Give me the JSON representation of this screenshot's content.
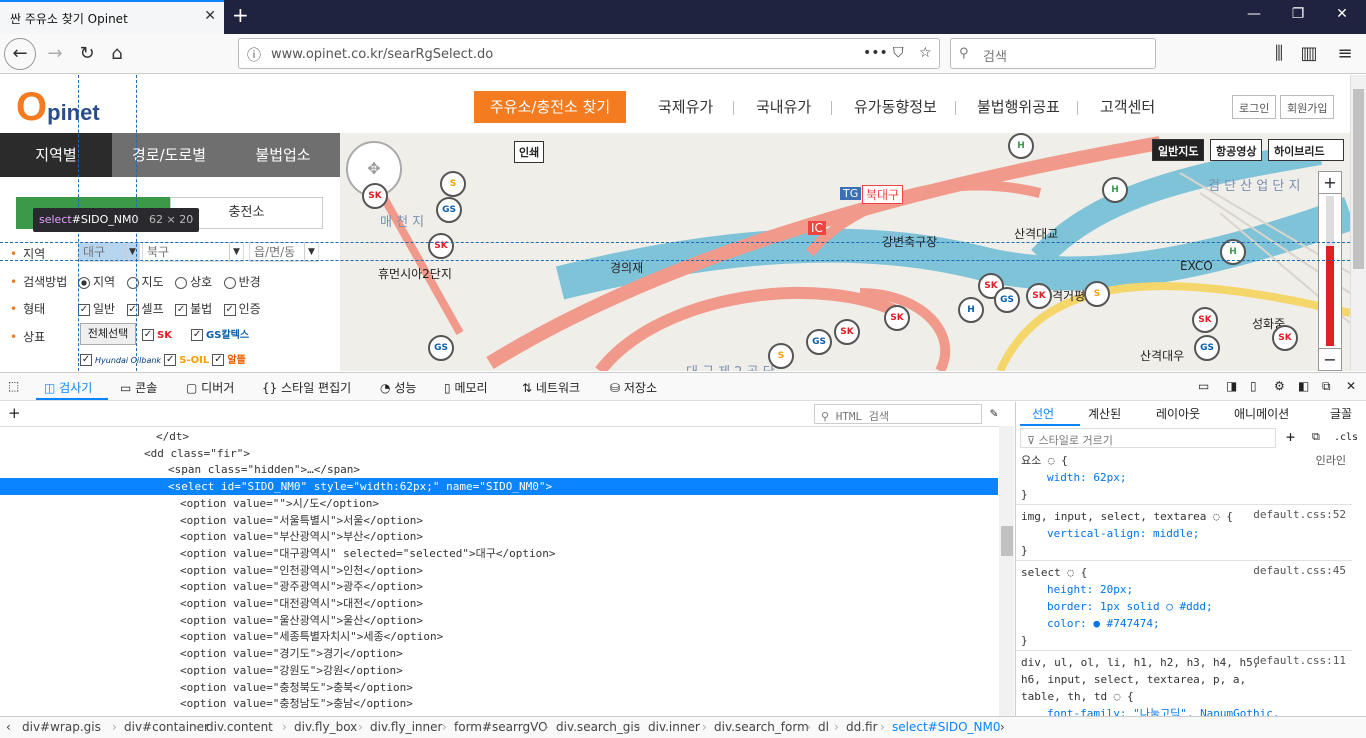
{
  "browser": {
    "tab_title": "싼 주유소 찾기 Opinet",
    "url": "www.opinet.co.kr/searRgSelect.do",
    "search_placeholder": "검색"
  },
  "site": {
    "logo_o": "O",
    "logo_rest": "pinet",
    "nav": [
      "주유소/충전소 찾기",
      "국제유가",
      "국내유가",
      "유가동향정보",
      "불법행위공표",
      "고객센터"
    ],
    "login": "로그인",
    "signup": "회원가입",
    "side_tabs": [
      "지역별",
      "경로/도로별",
      "불법업소"
    ],
    "fuel_tabs": [
      "주유소",
      "충전소"
    ],
    "region_label": "지역",
    "sido_value": "대구",
    "sigungu_value": "북구",
    "dong_value": "읍/면/동",
    "search_method_label": "검색방법",
    "search_methods": [
      "지역",
      "지도",
      "상호",
      "반경"
    ],
    "type_label": "형태",
    "types": [
      "일반",
      "셀프",
      "불법",
      "인증"
    ],
    "brand_label": "상표",
    "brand_all": "전체선택",
    "brands": [
      "SK",
      "GS칼텍스",
      "S-OIL",
      "알뜰"
    ],
    "brand_hyundai": "Hyundai Oilbank"
  },
  "map": {
    "print": "인쇄",
    "view_buttons": [
      "일반지도",
      "항공영상",
      "하이브리드"
    ],
    "labels": [
      "매 천 지",
      "휴먼시아2단지",
      "경의재",
      "북대구",
      "IC",
      "TG",
      "강변축구장",
      "산격대교",
      "EXCO",
      "검 단 산 업 단 지",
      "격거평",
      "성화중",
      "산격대우",
      "대 구 제 2 공 단"
    ],
    "zoom_plus": "+",
    "zoom_minus": "−"
  },
  "inspector_tooltip": {
    "tag": "select",
    "id": "#SIDO_NM0",
    "size": "62 × 20"
  },
  "devtools": {
    "tabs": [
      "검사기",
      "콘솔",
      "디버거",
      "스타일 편집기",
      "성능",
      "메모리",
      "네트워크",
      "저장소"
    ],
    "html_search": "HTML 검색",
    "markup": [
      {
        "indent": 13,
        "html": "</dt>"
      },
      {
        "indent": 12,
        "html": "<dd class=\"fir\">"
      },
      {
        "indent": 14,
        "html": "<span class=\"hidden\">…</span>"
      },
      {
        "indent": 14,
        "html": "<select id=\"SIDO_NM0\" style=\"width:62px;\" name=\"SIDO_NM0\">"
      },
      {
        "indent": 15,
        "html": "<option value=\"\">시/도</option>"
      },
      {
        "indent": 15,
        "html": "<option value=\"서울특별시\">서울</option>"
      },
      {
        "indent": 15,
        "html": "<option value=\"부산광역시\">부산</option>"
      },
      {
        "indent": 15,
        "html": "<option value=\"대구광역시\" selected=\"selected\">대구</option>"
      },
      {
        "indent": 15,
        "html": "<option value=\"인천광역시\">인천</option>"
      },
      {
        "indent": 15,
        "html": "<option value=\"광주광역시\">광주</option>"
      },
      {
        "indent": 15,
        "html": "<option value=\"대전광역시\">대전</option>"
      },
      {
        "indent": 15,
        "html": "<option value=\"울산광역시\">울산</option>"
      },
      {
        "indent": 15,
        "html": "<option value=\"세종특별자치시\">세종</option>"
      },
      {
        "indent": 15,
        "html": "<option value=\"경기도\">경기</option>"
      },
      {
        "indent": 15,
        "html": "<option value=\"강원도\">강원</option>"
      },
      {
        "indent": 15,
        "html": "<option value=\"충청북도\">충북</option>"
      },
      {
        "indent": 15,
        "html": "<option value=\"충청남도\">충남</option>"
      }
    ],
    "rules_tabs": [
      "선언",
      "계산된",
      "레이아웃",
      "애니메이션",
      "글꼴"
    ],
    "style_filter": "스타일로 거르기",
    "cls": ".cls",
    "rules": [
      {
        "selector": "요소 ◌ {",
        "source": "인라인",
        "decls": [
          "width: 62px;"
        ]
      },
      {
        "selector": "img, input, select, textarea ◌ {",
        "source": "default.css:52",
        "decls": [
          "vertical-align: middle;"
        ]
      },
      {
        "selector": "select ◌ {",
        "source": "default.css:45",
        "decls": [
          "height: 20px;",
          "border: 1px solid ○ #ddd;",
          "color: ● #747474;"
        ]
      },
      {
        "selector": "div, ul, ol, li, h1, h2, h3, h4, h5, h6, input, select, textarea, p, a, table, th, td ◌ {",
        "source": "default.css:11",
        "decls": [
          "font-family: \"나눔고딕\", NanumGothic,"
        ]
      }
    ],
    "breadcrumbs": [
      "div#wrap.gis",
      "div#container",
      "div.content",
      "div.fly_box",
      "div.fly_inner",
      "form#searrgVO",
      "div.search_gis",
      "div.inner",
      "div.search_form",
      "dl",
      "dd.fir",
      "select#SIDO_NM0"
    ]
  },
  "colors": {
    "accent": "#f47b20",
    "browser_dark": "#202340",
    "devtools_blue": "#0a84ff"
  }
}
